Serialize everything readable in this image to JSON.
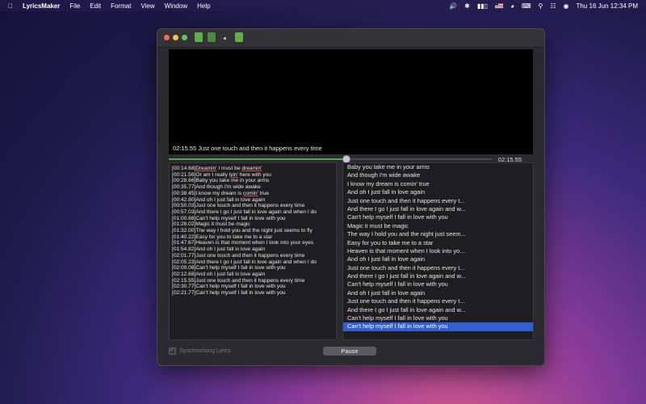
{
  "menubar": {
    "app": "LyricsMaker",
    "menus": [
      "File",
      "Edit",
      "Format",
      "View",
      "Window",
      "Help"
    ],
    "datetime": "Thu 16 Jun  12:34 PM"
  },
  "player": {
    "caption": "02:15.55 Just one touch and then it happens every time",
    "time": "02:15.55",
    "progress": 0.55
  },
  "lrc_lines": [
    {
      "ts": "[00:14.68]",
      "pre": "",
      "sp": "Dreamin'",
      "mid": " I must be ",
      "sp2": "dreamin'",
      "post": ""
    },
    {
      "ts": "[00:21.56]",
      "pre": "Or am I really ",
      "sp": "lyin'",
      "mid": " here with you",
      "sp2": "",
      "post": ""
    },
    {
      "ts": "[00:28.66]",
      "pre": "Baby you take me in your arms",
      "sp": "",
      "mid": "",
      "sp2": "",
      "post": ""
    },
    {
      "ts": "[00:35.77]",
      "pre": "And though I'm wide awake",
      "sp": "",
      "mid": "",
      "sp2": "",
      "post": ""
    },
    {
      "ts": "[00:38.45]",
      "pre": "I know my dream is ",
      "sp": "comin'",
      "mid": " true",
      "sp2": "",
      "post": ""
    },
    {
      "ts": "[00:42.80]",
      "pre": "And oh I just fall in love again",
      "sp": "",
      "mid": "",
      "sp2": "",
      "post": ""
    },
    {
      "ts": "[00:50.03]",
      "pre": "Just one touch and then it happens every time",
      "sp": "",
      "mid": "",
      "sp2": "",
      "post": ""
    },
    {
      "ts": "[00:57.03]",
      "pre": "And there I go I just fall in love again and when I do",
      "sp": "",
      "mid": "",
      "sp2": "",
      "post": ""
    },
    {
      "ts": "[01:00.68]",
      "pre": "Can't help myself I fall in love with you",
      "sp": "",
      "mid": "",
      "sp2": "",
      "post": ""
    },
    {
      "ts": "[01:26.02]",
      "pre": "Magic it must be magic",
      "sp": "",
      "mid": "",
      "sp2": "",
      "post": ""
    },
    {
      "ts": "[01:32.00]",
      "pre": "The way I hold you and the night just seems to fly",
      "sp": "",
      "mid": "",
      "sp2": "",
      "post": ""
    },
    {
      "ts": "[01:40.22]",
      "pre": "Easy for you to take me to a star",
      "sp": "",
      "mid": "",
      "sp2": "",
      "post": ""
    },
    {
      "ts": "[01:47.67]",
      "pre": "Heaven is that moment when I look into your eyes",
      "sp": "",
      "mid": "",
      "sp2": "",
      "post": ""
    },
    {
      "ts": "[01:54.82]",
      "pre": "And oh I just fall in love again",
      "sp": "",
      "mid": "",
      "sp2": "",
      "post": ""
    },
    {
      "ts": "[02:01.77]",
      "pre": "Just one touch and then it happens every time",
      "sp": "",
      "mid": "",
      "sp2": "",
      "post": ""
    },
    {
      "ts": "[02:05.23]",
      "pre": "And there I go I just fall in love again and when I do",
      "sp": "",
      "mid": "",
      "sp2": "",
      "post": ""
    },
    {
      "ts": "[02:09.08]",
      "pre": "Can't help myself I fall in love with you",
      "sp": "",
      "mid": "",
      "sp2": "",
      "post": ""
    },
    {
      "ts": "[02:12.68]",
      "pre": "And oh I just fall in love again",
      "sp": "",
      "mid": "",
      "sp2": "",
      "post": ""
    },
    {
      "ts": "[02:15.55]",
      "pre": "Just one touch and then it happens every time",
      "sp": "",
      "mid": "",
      "sp2": "",
      "post": ""
    },
    {
      "ts": "[02:30.77]",
      "pre": "Can't help myself I fall in love with you",
      "sp": "",
      "mid": "",
      "sp2": "",
      "post": ""
    },
    {
      "ts": "[02:21.77]",
      "pre": "Can't help myself I fall in love with you",
      "sp": "",
      "mid": "",
      "sp2": "",
      "post": ""
    }
  ],
  "lyric_list": [
    "Baby you take me in your arms",
    "And though I'm wide awake",
    "I know my dream is comin' true",
    "And oh I just fall in love again",
    "Just one touch and then it happens every t...",
    "And there I go I just fall in love again and w...",
    "Can't help myself I fall in love with you",
    "Magic it must be magic",
    "The way I hold you and the night just seem...",
    "Easy for you to take me to a star",
    "Heaven is that moment when I look into yo...",
    "And oh I just fall in love again",
    "Just one touch and then it happens every t...",
    "And there I go I just fall in love again and w...",
    "Can't help myself I fall in love with you",
    "And oh I just fall in love again",
    "Just one touch and then it happens every t...",
    "And there I go I just fall in love again and w...",
    "Can't help myself I fall in love with you",
    "Can't help myself I fall in love with you"
  ],
  "selected_index": 19,
  "footer": {
    "sync_label": "Synchronising Lyrics",
    "pause_label": "Pause"
  }
}
